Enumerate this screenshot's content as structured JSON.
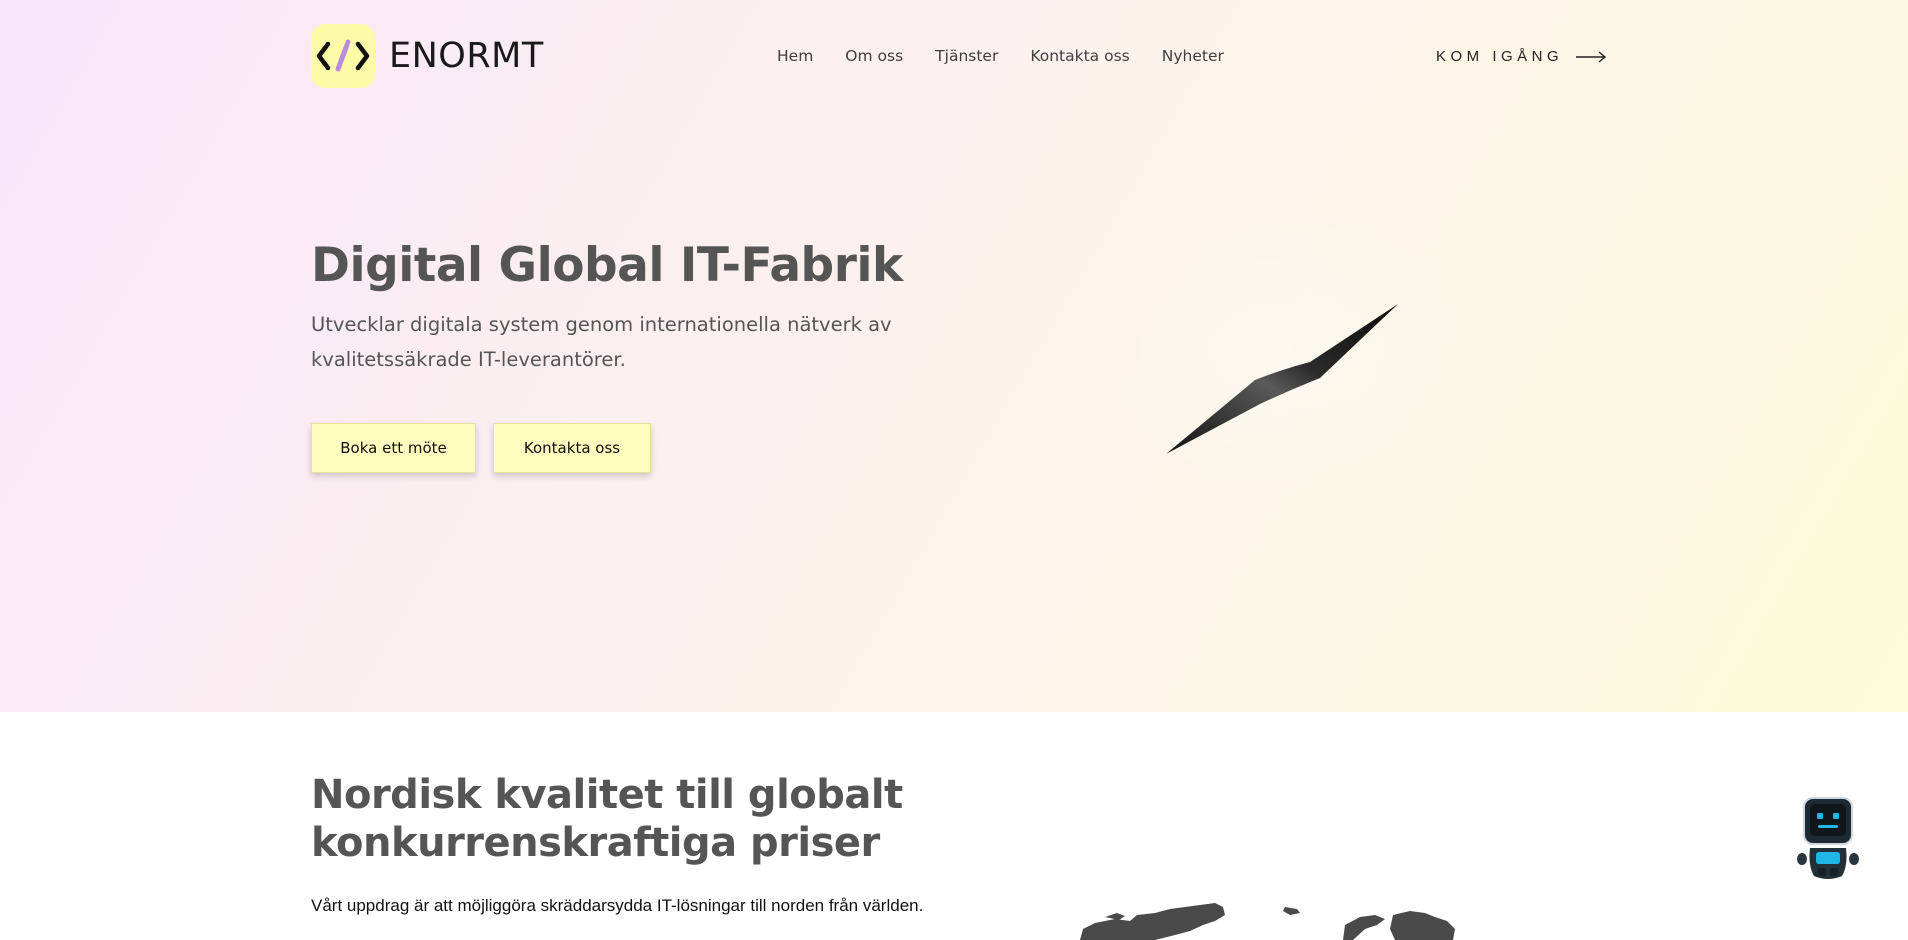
{
  "brand": {
    "name": "ENORMT",
    "logo_icon": "code-pencil-icon",
    "logo_color": "#fdfba8"
  },
  "nav": {
    "items": [
      {
        "label": "Hem"
      },
      {
        "label": "Om oss"
      },
      {
        "label": "Tjänster"
      },
      {
        "label": "Kontakta oss"
      },
      {
        "label": "Nyheter"
      }
    ],
    "cta_label": "KOM IGÅNG",
    "cta_icon": "arrow-right-icon"
  },
  "hero": {
    "title": "Digital Global IT-Fabrik",
    "subtitle": "Utvecklar digitala system genom internationella nätverk av kvalitetssäkrade IT-leverantörer.",
    "buttons": [
      {
        "label": "Boka ett möte"
      },
      {
        "label": "Kontakta oss"
      }
    ],
    "button_color": "#fefcbf"
  },
  "section": {
    "title": "Nordisk kvalitet till globalt konkurrenskraftiga priser",
    "text": "Vårt uppdrag är att möjliggöra skräddarsydda IT-lösningar till norden från världen."
  },
  "chatbot": {
    "icon": "robot-icon"
  }
}
